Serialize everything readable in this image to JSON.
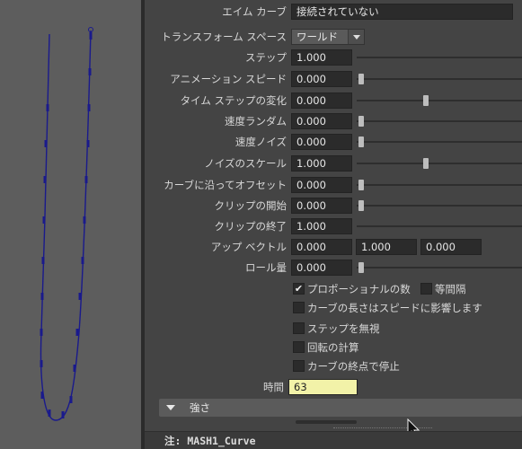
{
  "viewport": {
    "curve_color": "#1a1a8c"
  },
  "attributes": {
    "aim_curve": {
      "label": "エイム カーブ",
      "value": "接続されていない"
    },
    "transform_space": {
      "label": "トランスフォーム スペース",
      "value": "ワールド"
    },
    "step": {
      "label": "ステップ",
      "value": "1.000",
      "level": 0
    },
    "animation_speed": {
      "label": "アニメーション スピード",
      "value": "0.000",
      "level": 0
    },
    "time_step_variation": {
      "label": "タイム ステップの変化",
      "value": "0.000",
      "level": 0.5
    },
    "speed_random": {
      "label": "速度ランダム",
      "value": "0.000",
      "level": 0
    },
    "speed_noise": {
      "label": "速度ノイズ",
      "value": "0.000",
      "level": 0
    },
    "noise_scale": {
      "label": "ノイズのスケール",
      "value": "1.000",
      "level": 0.5
    },
    "offset_along_curve": {
      "label": "カーブに沿ってオフセット",
      "value": "0.000",
      "level": 0
    },
    "clip_start": {
      "label": "クリップの開始",
      "value": "0.000",
      "level": 0
    },
    "clip_end": {
      "label": "クリップの終了",
      "value": "1.000"
    },
    "up_vector": {
      "label": "アップ ベクトル",
      "values": [
        "0.000",
        "1.000",
        "0.000"
      ]
    },
    "roll": {
      "label": "ロール量",
      "value": "0.000",
      "level": 0
    }
  },
  "checkboxes": {
    "proportional": {
      "label": "プロポーショナルの数",
      "checked": true,
      "mark": "✔"
    },
    "equal_spacing": {
      "label": "等間隔",
      "checked": false
    },
    "curve_length_affects_speed": {
      "label": "カーブの長さはスピードに影響します",
      "checked": false
    },
    "ignore_step": {
      "label": "ステップを無視",
      "checked": false
    },
    "calculate_rotation": {
      "label": "回転の計算",
      "checked": false
    },
    "stop_at_curve_end": {
      "label": "カーブの終点で停止",
      "checked": false
    }
  },
  "time": {
    "label": "時間",
    "value": "63",
    "color": "#f2f2a8"
  },
  "section": {
    "title": "強さ"
  },
  "note": {
    "text": "注:  MASH1_Curve"
  }
}
